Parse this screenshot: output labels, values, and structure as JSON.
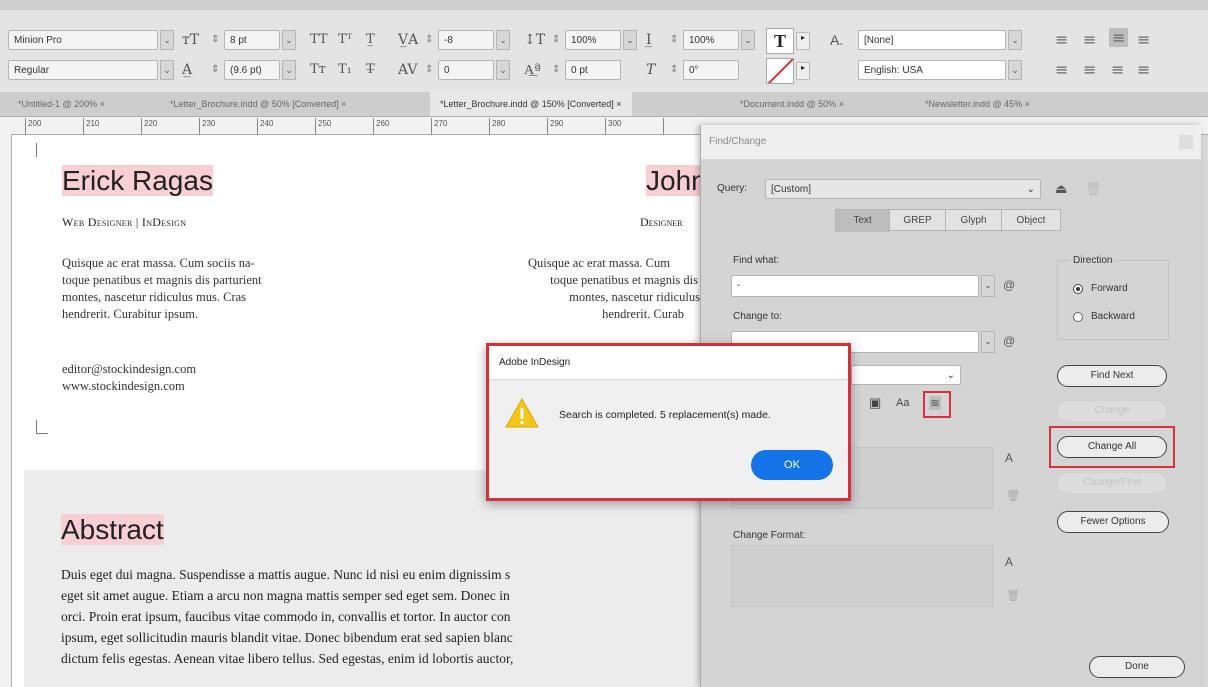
{
  "control_bar": {
    "font_family": "Minion Pro",
    "font_style": "Regular",
    "font_size": "8 pt",
    "leading": "(9.6 pt)",
    "kerning": "-8",
    "tracking": "0",
    "vertical_scale": "100%",
    "horizontal_scale": "100%",
    "baseline_shift": "0 pt",
    "skew": "0°",
    "char_style": "[None]",
    "language": "English: USA"
  },
  "tabs": [
    {
      "label": "*Untitled-1 @ 200% ×"
    },
    {
      "label": "*Letter_Brochure.indd @ 50% [Converted] ×"
    },
    {
      "label": "*Letter_Brochure.indd @ 150% [Converted] ×"
    },
    {
      "label": "*Document.indd @ 50% ×"
    },
    {
      "label": "*Newsletter.indd @ 45% ×"
    }
  ],
  "ruler": {
    "marks": [
      "200",
      "210",
      "220",
      "230",
      "240",
      "250",
      "260",
      "270",
      "280",
      "290",
      "300"
    ]
  },
  "document": {
    "person1": {
      "name": "Erick Ragas",
      "title": "Web Designer | InDesign",
      "bio": [
        "Quisque ac erat massa. Cum sociis na-",
        "toque penatibus et magnis dis parturient",
        "montes, nascetur ridiculus mus. Cras",
        "hendrerit. Curabitur ipsum."
      ],
      "email": "editor@stockindesign.com",
      "web": "www.stockindesign.com"
    },
    "person2": {
      "name": "John",
      "title": "Designer",
      "bio": [
        "Quisque ac erat massa. Cum",
        "toque penatibus et magnis dis",
        "montes, nascetur ridiculus",
        "hendrerit. Curab"
      ]
    },
    "abstract": {
      "heading": "Abstract",
      "lines": [
        "Duis eget dui magna. Suspendisse a mattis augue. Nunc id nisi eu enim dignissim s",
        "eget sit amet augue. Etiam a arcu non magna mattis semper sed eget sem. Donec in",
        "orci. Proin erat ipsum, faucibus vitae commodo in, convallis et tortor. In auctor con",
        "ipsum, eget sollicitudin mauris blandit vitae. Donec bibendum erat sed sapien blanc",
        "dictum felis egestas. Aenean vitae libero tellus. Sed egestas, enim id lobortis auctor,"
      ]
    }
  },
  "find_change": {
    "title": "Find/Change",
    "query_label": "Query:",
    "query_value": "[Custom]",
    "tabs": [
      "Text",
      "GREP",
      "Glyph",
      "Object"
    ],
    "find_what_label": "Find what:",
    "find_what_value": "-",
    "change_to_label": "Change to:",
    "direction_label": "Direction",
    "direction_options": [
      "Forward",
      "Backward"
    ],
    "buttons": {
      "find_next": "Find Next",
      "change": "Change",
      "change_all": "Change All",
      "change_find": "Change/Find",
      "fewer_options": "Fewer Options",
      "done": "Done"
    },
    "change_format_label": "Change Format:"
  },
  "alert": {
    "title": "Adobe InDesign",
    "message": "Search is completed.  5 replacement(s) made.",
    "ok_label": "OK"
  }
}
